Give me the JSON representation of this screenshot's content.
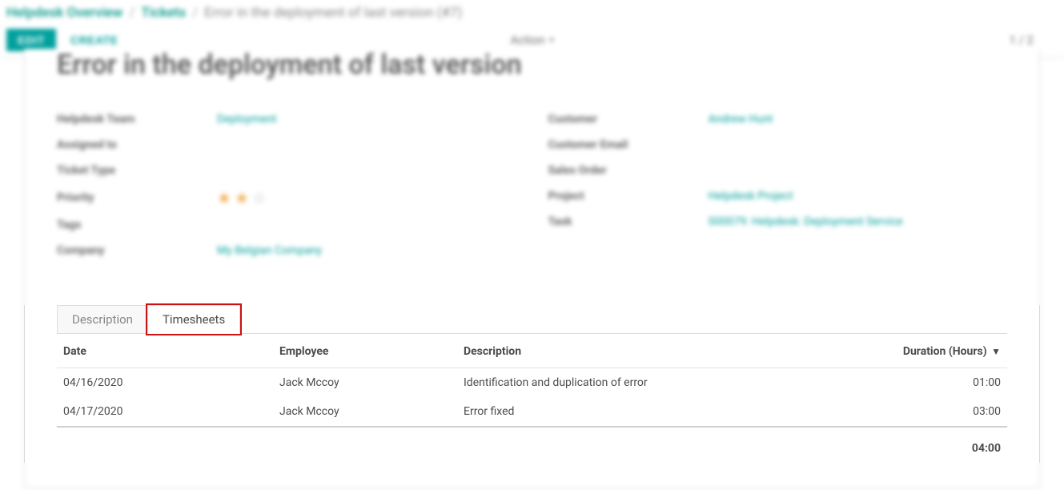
{
  "breadcrumb": {
    "root": "Helpdesk Overview",
    "mid": "Tickets",
    "current": "Error in the deployment of last version (#7)"
  },
  "toolbar": {
    "edit": "EDIT",
    "create": "CREATE",
    "action": "Action",
    "pager": "1 / 2"
  },
  "record": {
    "title": "Error in the deployment of last version",
    "left": {
      "helpdesk_team_label": "Helpdesk Team",
      "helpdesk_team": "Deployment",
      "assigned_to_label": "Assigned to",
      "assigned_to": "",
      "ticket_type_label": "Ticket Type",
      "ticket_type": "",
      "priority_label": "Priority",
      "tags_label": "Tags",
      "tags": "",
      "company_label": "Company",
      "company": "My Belgian Company"
    },
    "right": {
      "customer_label": "Customer",
      "customer": "Andrew Hunt",
      "customer_email_label": "Customer Email",
      "customer_email": "",
      "sales_order_label": "Sales Order",
      "sales_order": "",
      "project_label": "Project",
      "project": "Helpdesk Project",
      "task_label": "Task",
      "task": "S00079: Helpdesk: Deployment Service"
    },
    "priority_stars": {
      "filled": 2,
      "total": 3
    }
  },
  "tabs": {
    "description": "Description",
    "timesheets": "Timesheets"
  },
  "timesheet_table": {
    "headers": {
      "date": "Date",
      "employee": "Employee",
      "description": "Description",
      "duration": "Duration (Hours)"
    },
    "rows": [
      {
        "date": "04/16/2020",
        "employee": "Jack Mccoy",
        "description": "Identification and duplication of error",
        "duration": "01:00"
      },
      {
        "date": "04/17/2020",
        "employee": "Jack Mccoy",
        "description": "Error fixed",
        "duration": "03:00"
      }
    ],
    "total": "04:00"
  }
}
